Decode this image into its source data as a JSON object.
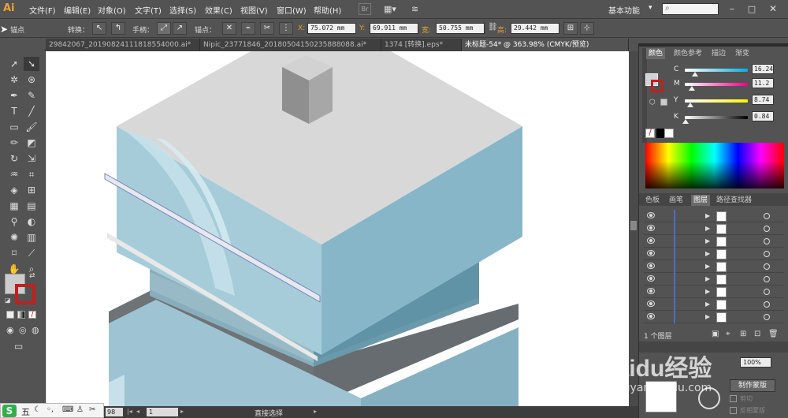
{
  "app": {
    "logo": "Ai",
    "workspace": "基本功能",
    "workspace_arrow": "▾"
  },
  "menu": [
    "文件(F)",
    "编辑(E)",
    "对象(O)",
    "文字(T)",
    "选择(S)",
    "效果(C)",
    "视图(V)",
    "窗口(W)",
    "帮助(H)"
  ],
  "control_bar": {
    "anchor_label": "锚点",
    "convert_label": "转换：",
    "handle_label": "手柄：",
    "anchor_label2": "锚点：",
    "x_label": "X:",
    "x_value": "75.072 mm",
    "y_label": "Y:",
    "y_value": "69.911 mm",
    "w_label": "宽:",
    "w_value": "50.755 mm",
    "h_label": "高:",
    "h_value": "29.442 mm"
  },
  "tabs": [
    {
      "label": "29842067_20190824111818554000.ai*",
      "active": false
    },
    {
      "label": "Nipic_23771846_20180504150235888088.ai*",
      "active": false
    },
    {
      "label": "1374 [转换].eps*",
      "active": false
    },
    {
      "label": "未标题-54* @ 363.98% (CMYK/预览)",
      "active": true
    }
  ],
  "status": {
    "zoom": "98",
    "page": "1",
    "mode": "直接选择"
  },
  "color_panel": {
    "tabs": [
      "颜色",
      "颜色参考",
      "描边",
      "渐变"
    ],
    "channels": [
      {
        "name": "C",
        "value": "16.24",
        "color_from": "#ffffff",
        "color_to": "#00aeef",
        "level": 0.16
      },
      {
        "name": "M",
        "value": "11.2",
        "color_from": "#ffffff",
        "color_to": "#ec008c",
        "level": 0.11
      },
      {
        "name": "Y",
        "value": "8.74",
        "color_from": "#ffffff",
        "color_to": "#fff200",
        "level": 0.09
      },
      {
        "name": "K",
        "value": "0.84",
        "color_from": "#ffffff",
        "color_to": "#000000",
        "level": 0.01
      }
    ]
  },
  "layers_panel": {
    "tabs": [
      "色板",
      "画笔",
      "图层",
      "路径查找器"
    ],
    "rows": 9,
    "count_label": "1 个图层"
  },
  "mask_button": "制作蒙版",
  "opacity_value": "100%",
  "checkbox_clip": "剪切",
  "checkbox_invert": "反相蒙版",
  "ime": {
    "logo": "S",
    "text": "五"
  },
  "watermark": {
    "brand": "Baidu经验",
    "url": "jingyan.baidu.com"
  }
}
